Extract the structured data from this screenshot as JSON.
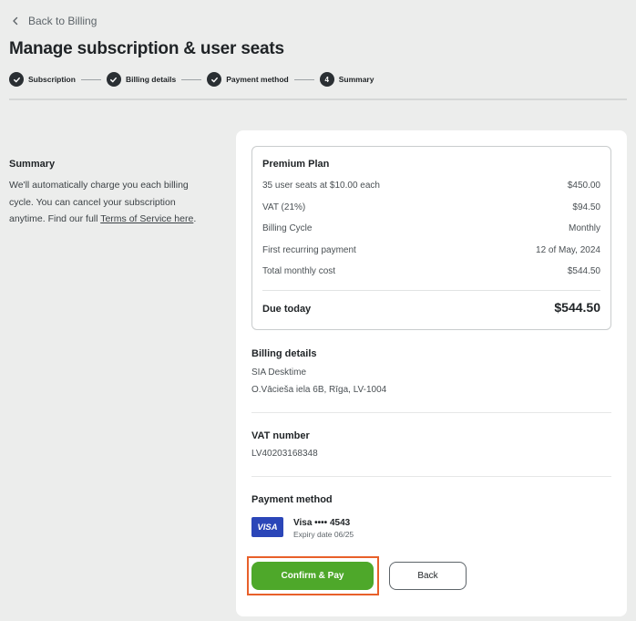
{
  "back_link": {
    "label": "Back to Billing",
    "icon": "chevron-left-icon"
  },
  "page_title": "Manage subscription & user seats",
  "stepper": {
    "steps": [
      {
        "label": "Subscription",
        "state": "completed",
        "icon": "check-icon"
      },
      {
        "label": "Billing details",
        "state": "completed",
        "icon": "check-icon"
      },
      {
        "label": "Payment method",
        "state": "completed",
        "icon": "check-icon"
      },
      {
        "label": "Summary",
        "state": "current",
        "number": "4"
      }
    ]
  },
  "side": {
    "title": "Summary",
    "text": "We'll automatically charge you each billing cycle. You can cancel your subscription anytime. Find our full ",
    "link": "Terms of Service here",
    "text_end": "."
  },
  "plan": {
    "title": "Premium Plan",
    "rows": [
      {
        "label": "35 user seats at $10.00 each",
        "value": "$450.00"
      },
      {
        "label": "VAT (21%)",
        "value": "$94.50"
      },
      {
        "label": "Billing Cycle",
        "value": "Monthly"
      },
      {
        "label": "First recurring payment",
        "value": "12 of May, 2024"
      },
      {
        "label": "Total monthly cost",
        "value": "$544.50"
      }
    ],
    "due_label": "Due today",
    "due_value": "$544.50"
  },
  "billing": {
    "title": "Billing details",
    "company": "SIA Desktime",
    "address": "O.Vācieša iela 6B, Rīga, LV-1004"
  },
  "vat": {
    "title": "VAT number",
    "value": "LV40203168348"
  },
  "payment": {
    "title": "Payment method",
    "logo_text": "VISA",
    "card": "Visa •••• 4543",
    "expiry": "Expiry date 06/25"
  },
  "actions": {
    "confirm_label": "Confirm & Pay",
    "back_label": "Back"
  },
  "colors": {
    "background": "#ecedec",
    "accent_green": "#4ea82a",
    "highlight_orange": "#e8602a",
    "visa_blue": "#2b46b8",
    "step_dark": "#2a2f33"
  }
}
